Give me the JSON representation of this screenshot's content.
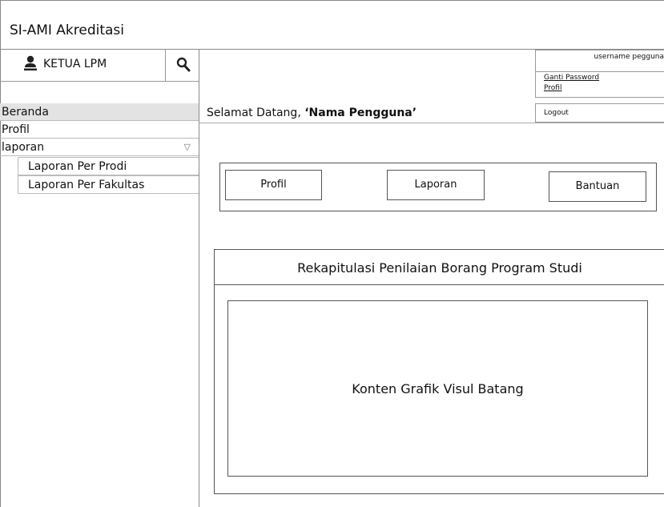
{
  "app": {
    "title": "SI-AMI Akreditasi"
  },
  "user": {
    "role": "KETUA LPM",
    "username": "username pegguna"
  },
  "account_menu": {
    "change_password": "Ganti Password",
    "profile": "Profil",
    "logout": "Logout"
  },
  "sidebar": {
    "items": [
      {
        "label": "Beranda"
      },
      {
        "label": "Profil"
      },
      {
        "label": "laporan",
        "caret": "▽"
      }
    ],
    "subitems": [
      {
        "label": "Laporan Per Prodi"
      },
      {
        "label": "Laporan Per Fakultas"
      }
    ]
  },
  "welcome": {
    "prefix": "Selamat Datang, ",
    "name": "‘Nama Pengguna’"
  },
  "buttons": {
    "profil": "Profil",
    "laporan": "Laporan",
    "bantuan": "Bantuan"
  },
  "rekap": {
    "title": "Rekapitulasi  Penilaian Borang Program Studi",
    "chart_placeholder": "Konten Grafik Visul Batang"
  }
}
